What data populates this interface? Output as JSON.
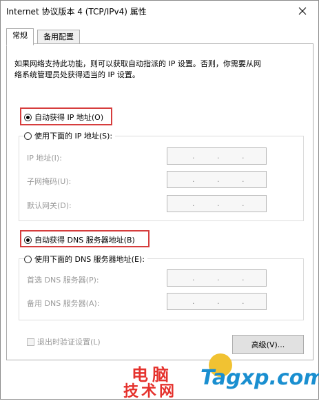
{
  "window": {
    "title": "Internet 协议版本 4 (TCP/IPv4) 属性"
  },
  "tabs": [
    {
      "label": "常规"
    },
    {
      "label": "备用配置"
    }
  ],
  "description": {
    "line1": "如果网络支持此功能，则可以获取自动指派的 IP 设置。否则，你需要从网",
    "line2": "络系统管理员处获得适当的 IP 设置。"
  },
  "ip": {
    "auto_label": "自动获得 IP 地址(O)",
    "manual_label": "使用下面的 IP 地址(S):",
    "fields": [
      {
        "label": "IP 地址(I):"
      },
      {
        "label": "子网掩码(U):"
      },
      {
        "label": "默认网关(D):"
      }
    ]
  },
  "dns": {
    "auto_label": "自动获得 DNS 服务器地址(B)",
    "manual_label": "使用下面的 DNS 服务器地址(E):",
    "fields": [
      {
        "label": "首选 DNS 服务器(P):"
      },
      {
        "label": "备用 DNS 服务器(A):"
      }
    ]
  },
  "validate_label": "退出时验证设置(L)",
  "advanced_label": "高级(V)...",
  "ip_separator": ".",
  "watermark": {
    "cn_line1": "电脑",
    "cn_line2": "技术网",
    "site": "Tagxp.com"
  },
  "colors": {
    "highlight": "#d63d3d",
    "watermark_red": "#e5322d",
    "watermark_blue": "#1a8fd0"
  }
}
